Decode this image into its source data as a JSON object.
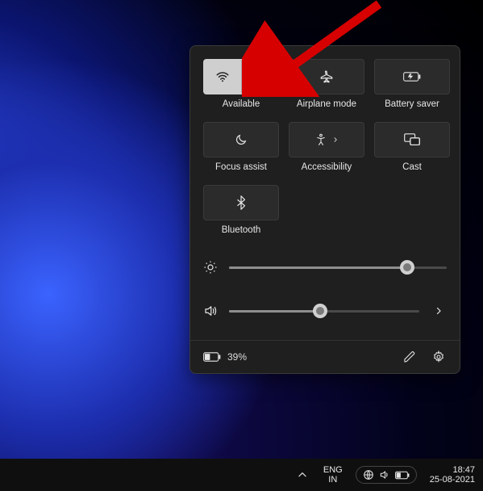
{
  "quick_settings": {
    "tiles": {
      "wifi": {
        "label": "Available"
      },
      "airplane": {
        "label": "Airplane mode"
      },
      "battery_saver": {
        "label": "Battery saver"
      },
      "focus_assist": {
        "label": "Focus assist"
      },
      "accessibility": {
        "label": "Accessibility"
      },
      "cast": {
        "label": "Cast"
      },
      "bluetooth": {
        "label": "Bluetooth"
      }
    },
    "sliders": {
      "brightness_percent": 82,
      "volume_percent": 48
    },
    "battery_text": "39%"
  },
  "taskbar": {
    "lang_line1": "ENG",
    "lang_line2": "IN",
    "time": "18:47",
    "date": "25-08-2021"
  }
}
